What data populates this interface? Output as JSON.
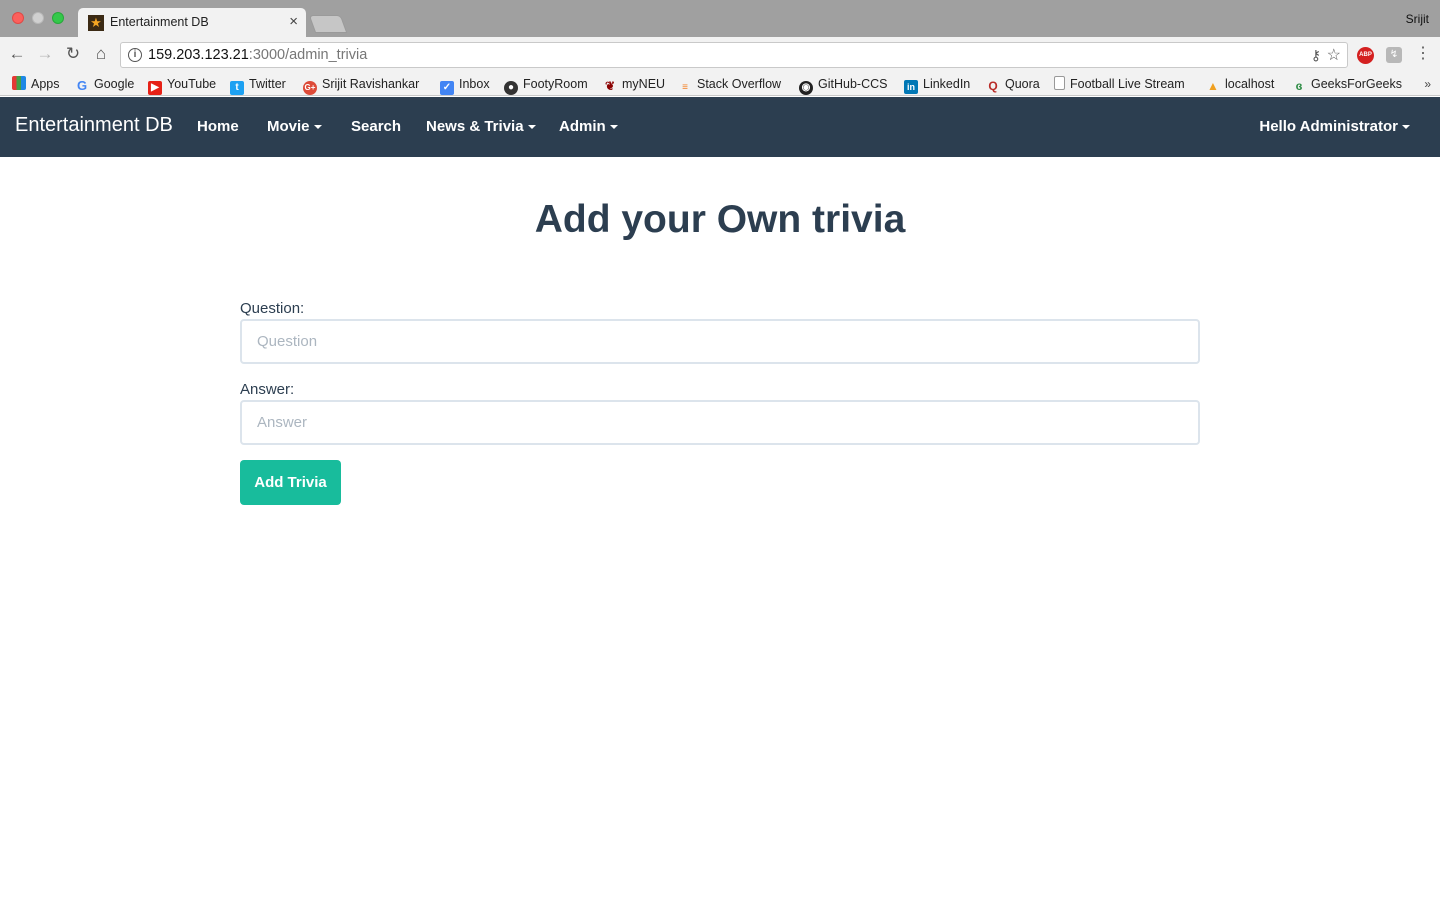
{
  "browser": {
    "tab_title": "Entertainment DB",
    "tab_close": "×",
    "profile_name": "Srijit",
    "url_host": "159.203.123.21",
    "url_path": ":3000/admin_trivia",
    "abp_label": "ABP",
    "bookmarks": [
      {
        "label": "Apps",
        "icon": "apps-grid-icon"
      },
      {
        "label": "Google",
        "icon": "google-icon"
      },
      {
        "label": "YouTube",
        "icon": "youtube-icon"
      },
      {
        "label": "Twitter",
        "icon": "twitter-icon"
      },
      {
        "label": "Srijit Ravishankar",
        "icon": "google-plus-icon"
      },
      {
        "label": "Inbox",
        "icon": "inbox-icon"
      },
      {
        "label": "FootyRoom",
        "icon": "footyroom-icon"
      },
      {
        "label": "myNEU",
        "icon": "paw-icon"
      },
      {
        "label": "Stack Overflow",
        "icon": "stackoverflow-icon"
      },
      {
        "label": "GitHub-CCS",
        "icon": "github-icon"
      },
      {
        "label": "LinkedIn",
        "icon": "linkedin-icon"
      },
      {
        "label": "Quora",
        "icon": "quora-icon"
      },
      {
        "label": "Football Live Stream",
        "icon": "page-icon"
      },
      {
        "label": "localhost",
        "icon": "localhost-icon"
      },
      {
        "label": "GeeksForGeeks",
        "icon": "geeksforgeeks-icon"
      }
    ],
    "bookmarks_more": "»"
  },
  "navbar": {
    "brand": "Entertainment DB",
    "items": [
      "Home",
      "Movie",
      "Search",
      "News & Trivia",
      "Admin"
    ],
    "user_menu": "Hello Administrator"
  },
  "page": {
    "title": "Add your Own trivia",
    "question_label": "Question:",
    "question_placeholder": "Question",
    "question_value": "",
    "answer_label": "Answer:",
    "answer_placeholder": "Answer",
    "answer_value": "",
    "submit_label": "Add Trivia"
  },
  "colors": {
    "navbar": "#2c3e50",
    "primary_text": "#2c3e50",
    "success_button": "#18bc9c"
  }
}
